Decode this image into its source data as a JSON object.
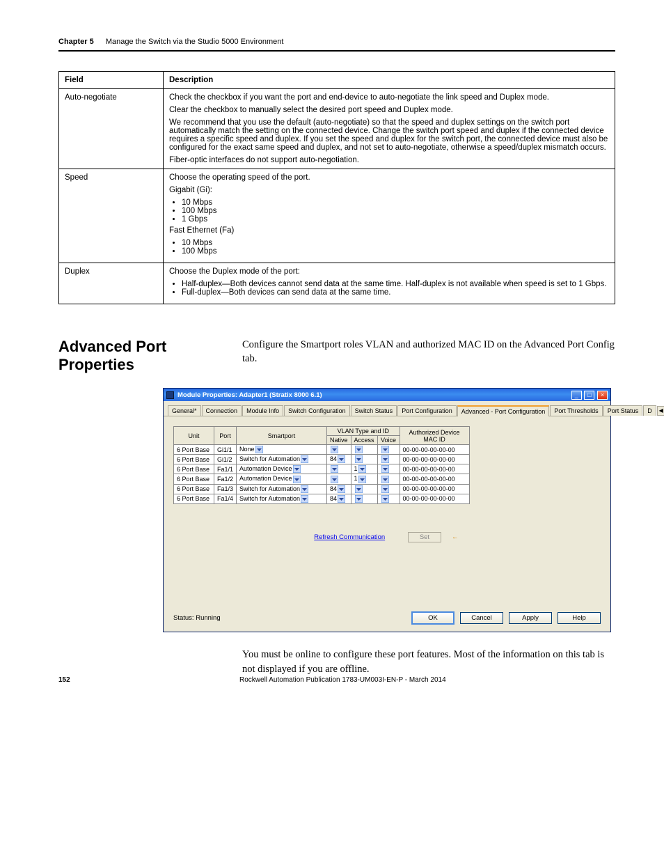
{
  "header": {
    "chapter": "Chapter 5",
    "title": "Manage the Switch via the Studio 5000 Environment"
  },
  "table": {
    "hdr_field": "Field",
    "hdr_desc": "Description",
    "r1_f": "Auto-negotiate",
    "r1_p1": "Check the checkbox if you want the port and end-device to auto-negotiate the link speed and Duplex mode.",
    "r1_p2": "Clear the checkbox to manually select the desired port speed and Duplex mode.",
    "r1_p3": "We recommend that you use the default (auto-negotiate) so that the speed and duplex settings on the switch port automatically match the setting on the connected device. Change the switch port speed and duplex if the connected device requires a specific speed and duplex. If you set the speed and duplex for the switch port, the connected device must also be configured for the exact same speed and duplex, and not set to auto-negotiate, otherwise a speed/duplex mismatch occurs.",
    "r1_p4": "Fiber-optic interfaces do not support auto-negotiation.",
    "r2_f": "Speed",
    "r2_p1": "Choose the operating speed of the port.",
    "r2_gi": "Gigabit (Gi):",
    "r2_gi1": "10 Mbps",
    "r2_gi2": "100 Mbps",
    "r2_gi3": "1 Gbps",
    "r2_fa": "Fast Ethernet (Fa)",
    "r2_fa1": "10 Mbps",
    "r2_fa2": "100 Mbps",
    "r3_f": "Duplex",
    "r3_p1": "Choose the Duplex mode of the port:",
    "r3_b1": "Half-duplex—Both devices cannot send data at the same time. Half-duplex is not available when speed is set to 1 Gbps.",
    "r3_b2": "Full-duplex—Both devices can send data at the same time."
  },
  "section": {
    "title": "Advanced Port Properties",
    "intro": "Configure the Smartport roles VLAN and authorized MAC ID on the Advanced Port Config tab."
  },
  "dialog": {
    "titletext": "Module Properties: Adapter1 (Stratix 8000 6.1)",
    "tabs": {
      "general": "General*",
      "connection": "Connection",
      "modinfo": "Module Info",
      "swconf": "Switch Configuration",
      "swstat": "Switch Status",
      "portconf": "Port Configuration",
      "advport": "Advanced - Port Configuration",
      "portthr": "Port Thresholds",
      "portstat": "Port Status",
      "d": "D"
    },
    "grid_hdr": {
      "unit": "Unit",
      "port": "Port",
      "smartport": "Smartport",
      "vlan_group": "VLAN Type and ID",
      "native": "Native",
      "access": "Access",
      "voice": "Voice",
      "mac": "Authorized Device MAC ID"
    },
    "rows": [
      {
        "unit": "6 Port Base",
        "port": "Gi1/1",
        "sp": "None",
        "native": "",
        "access": "",
        "voice": "",
        "mac": "00-00-00-00-00-00"
      },
      {
        "unit": "6 Port Base",
        "port": "Gi1/2",
        "sp": "Switch for Automation",
        "native": "84",
        "access": "",
        "voice": "",
        "mac": "00-00-00-00-00-00"
      },
      {
        "unit": "6 Port Base",
        "port": "Fa1/1",
        "sp": "Automation Device",
        "native": "",
        "access": "1",
        "voice": "",
        "mac": "00-00-00-00-00-00"
      },
      {
        "unit": "6 Port Base",
        "port": "Fa1/2",
        "sp": "Automation Device",
        "native": "",
        "access": "1",
        "voice": "",
        "mac": "00-00-00-00-00-00"
      },
      {
        "unit": "6 Port Base",
        "port": "Fa1/3",
        "sp": "Switch for Automation",
        "native": "84",
        "access": "",
        "voice": "",
        "mac": "00-00-00-00-00-00"
      },
      {
        "unit": "6 Port Base",
        "port": "Fa1/4",
        "sp": "Switch for Automation",
        "native": "84",
        "access": "",
        "voice": "",
        "mac": "00-00-00-00-00-00"
      }
    ],
    "refresh": "Refresh Communication",
    "setbtn": "Set",
    "status": "Status: Running",
    "ok": "OK",
    "cancel": "Cancel",
    "apply": "Apply",
    "help": "Help"
  },
  "after": "You must be online to configure these port features. Most of the information on this tab is not displayed if you are offline.",
  "footer": {
    "page": "152",
    "pub": "Rockwell Automation Publication 1783-UM003I-EN-P - March 2014"
  }
}
